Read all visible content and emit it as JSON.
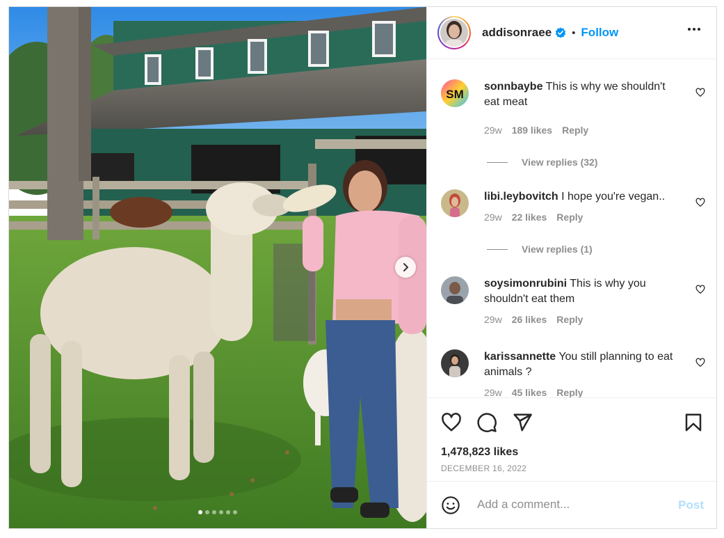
{
  "post": {
    "author": {
      "username": "addisonraee",
      "verified": true,
      "separator": "•",
      "follow_label": "Follow"
    },
    "media": {
      "slide_count": 6,
      "active_slide": 1
    },
    "comments": [
      {
        "username": "sonnbaybe",
        "text": "This is why we shouldn't eat meat",
        "age": "29w",
        "likes": "189 likes",
        "reply_label": "Reply",
        "view_replies": "View replies (32)",
        "avatar_text": "SM"
      },
      {
        "username": "libi.leybovitch",
        "text": "I hope you're vegan..",
        "age": "29w",
        "likes": "22 likes",
        "reply_label": "Reply",
        "view_replies": "View replies (1)"
      },
      {
        "username": "soysimonrubini",
        "text": "This is why you shouldn't eat them",
        "age": "29w",
        "likes": "26 likes",
        "reply_label": "Reply"
      },
      {
        "username": "karissannette",
        "text": "You still planning to eat animals ?",
        "age": "29w",
        "likes": "45 likes",
        "reply_label": "Reply"
      }
    ],
    "likes_count": "1,478,823 likes",
    "date": "DECEMBER 16, 2022",
    "comment_input": {
      "placeholder": "Add a comment...",
      "post_label": "Post"
    },
    "icons": {
      "like": "heart-icon",
      "comment": "comment-bubble-icon",
      "share": "paper-plane-icon",
      "save": "bookmark-icon",
      "emoji": "smiley-icon",
      "more": "more-options-icon",
      "next": "chevron-right-icon"
    },
    "colors": {
      "accent": "#0095f6",
      "text": "#262626",
      "secondary": "#8e8e8e",
      "post_disabled": "#b2dffc"
    }
  }
}
